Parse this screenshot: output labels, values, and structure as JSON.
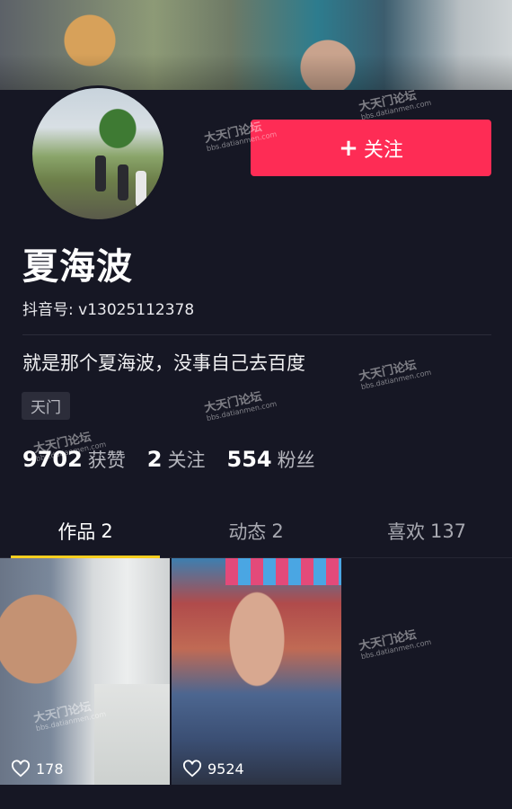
{
  "profile": {
    "name": "夏海波",
    "uid_label": "抖音号:",
    "uid": "v13025112378",
    "bio": "就是那个夏海波，没事自己去百度",
    "tag": "天门"
  },
  "follow_button": {
    "plus": "+",
    "label": "关注"
  },
  "stats": [
    {
      "num": "9702",
      "label": "获赞"
    },
    {
      "num": "2",
      "label": "关注"
    },
    {
      "num": "554",
      "label": "粉丝"
    }
  ],
  "tabs": [
    {
      "label": "作品",
      "count": "2",
      "active": true
    },
    {
      "label": "动态",
      "count": "2",
      "active": false
    },
    {
      "label": "喜欢",
      "count": "137",
      "active": false
    }
  ],
  "videos": [
    {
      "likes": "178"
    },
    {
      "likes": "9524"
    }
  ],
  "watermark": {
    "title": "大天门论坛",
    "sub": "bbs.datianmen.com"
  },
  "colors": {
    "background": "#161724",
    "follow": "#fe2c55",
    "tab_indicator": "#facf1f"
  },
  "icons": {
    "like": "heart-outline-icon"
  }
}
